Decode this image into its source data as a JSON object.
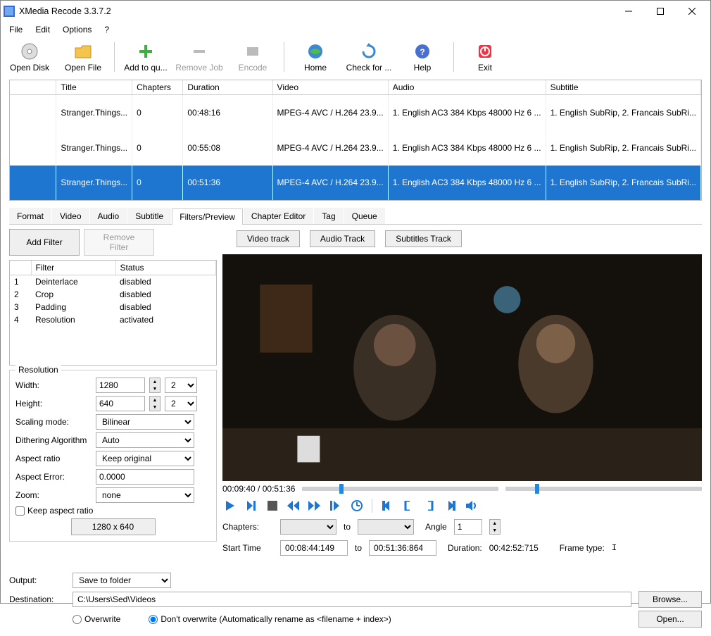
{
  "window": {
    "title": "XMedia Recode 3.3.7.2"
  },
  "menu": {
    "file": "File",
    "edit": "Edit",
    "options": "Options",
    "help": "?"
  },
  "toolbar": {
    "open_disk": "Open Disk",
    "open_file": "Open File",
    "add_queue": "Add to qu...",
    "remove_job": "Remove Job",
    "encode": "Encode",
    "home": "Home",
    "check_updates": "Check for ...",
    "help": "Help",
    "exit": "Exit"
  },
  "filelist": {
    "headers": {
      "title": "Title",
      "chapters": "Chapters",
      "duration": "Duration",
      "video": "Video",
      "audio": "Audio",
      "subtitle": "Subtitle"
    },
    "rows": [
      {
        "title": "Stranger.Things...",
        "chapters": "0",
        "duration": "00:48:16",
        "video": "MPEG-4 AVC / H.264 23.9...",
        "audio": "1. English AC3 384 Kbps 48000 Hz 6 ...",
        "subtitle": "1. English SubRip, 2. Francais SubRi...",
        "selected": false
      },
      {
        "title": "Stranger.Things...",
        "chapters": "0",
        "duration": "00:55:08",
        "video": "MPEG-4 AVC / H.264 23.9...",
        "audio": "1. English AC3 384 Kbps 48000 Hz 6 ...",
        "subtitle": "1. English SubRip, 2. Francais SubRi...",
        "selected": false
      },
      {
        "title": "Stranger.Things...",
        "chapters": "0",
        "duration": "00:51:36",
        "video": "MPEG-4 AVC / H.264 23.9...",
        "audio": "1. English AC3 384 Kbps 48000 Hz 6 ...",
        "subtitle": "1. English SubRip, 2. Francais SubRi...",
        "selected": true
      }
    ]
  },
  "tabs": [
    "Format",
    "Video",
    "Audio",
    "Subtitle",
    "Filters/Preview",
    "Chapter Editor",
    "Tag",
    "Queue"
  ],
  "active_tab": 4,
  "filter_btns": {
    "add": "Add Filter",
    "remove": "Remove Filter"
  },
  "filter_table": {
    "headers": {
      "idx": "",
      "filter": "Filter",
      "status": "Status"
    },
    "rows": [
      {
        "idx": "1",
        "filter": "Deinterlace",
        "status": "disabled"
      },
      {
        "idx": "2",
        "filter": "Crop",
        "status": "disabled"
      },
      {
        "idx": "3",
        "filter": "Padding",
        "status": "disabled"
      },
      {
        "idx": "4",
        "filter": "Resolution",
        "status": "activated"
      }
    ]
  },
  "resolution": {
    "legend": "Resolution",
    "width_label": "Width:",
    "width_value": "1280",
    "width_step": "2",
    "height_label": "Height:",
    "height_value": "640",
    "height_step": "2",
    "scaling_label": "Scaling mode:",
    "scaling_value": "Bilinear",
    "dither_label": "Dithering Algorithm",
    "dither_value": "Auto",
    "aspect_label": "Aspect ratio",
    "aspect_value": "Keep original",
    "error_label": "Aspect Error:",
    "error_value": "0.0000",
    "zoom_label": "Zoom:",
    "zoom_value": "none",
    "keep_aspect": "Keep aspect ratio",
    "dims_btn": "1280 x 640"
  },
  "track_btns": {
    "video": "Video track",
    "audio": "Audio Track",
    "subtitle": "Subtitles Track"
  },
  "timeline": {
    "pos": "00:09:40",
    "total": "00:51:36",
    "percent": 18.7
  },
  "chapters": {
    "label": "Chapters:",
    "to": "to",
    "angle_label": "Angle",
    "angle_value": "1"
  },
  "timerow": {
    "start_label": "Start Time",
    "start_value": "00:08:44:149",
    "to": "to",
    "end_value": "00:51:36:864",
    "duration_label": "Duration:",
    "duration_value": "00:42:52:715",
    "frametype_label": "Frame type:",
    "frametype_value": "I"
  },
  "output": {
    "output_label": "Output:",
    "output_value": "Save to folder",
    "dest_label": "Destination:",
    "dest_value": "C:\\Users\\Sed\\Videos",
    "browse": "Browse...",
    "open": "Open...",
    "overwrite": "Overwrite",
    "dont_overwrite": "Don't overwrite (Automatically rename as <filename + index>)"
  }
}
